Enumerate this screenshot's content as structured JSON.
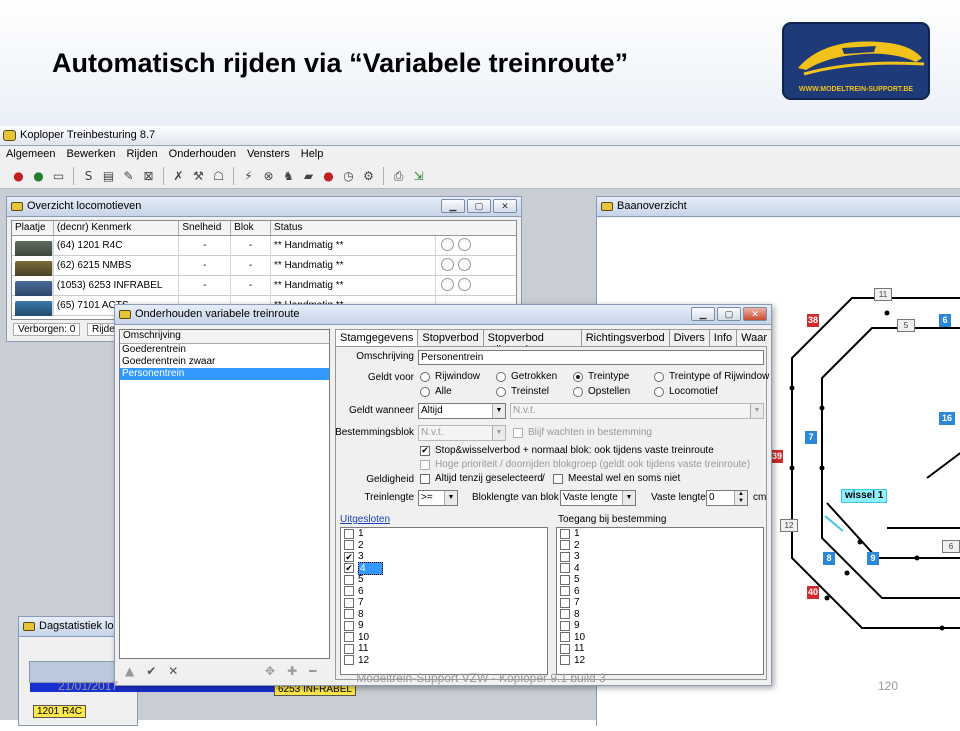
{
  "slide": {
    "title": "Automatisch rijden via “Variabele treinroute”",
    "logo_text": "WWW.MODELTREIN-SUPPORT.BE",
    "footer_date": "21/01/2017",
    "footer_center": "Modeltrein-Support  VZW - Koploper 9.1 build 3",
    "page_number": "120"
  },
  "app": {
    "title": "Koploper Treinbesturing 8.7",
    "menu": [
      "Algemeen",
      "Bewerken",
      "Rijden",
      "Onderhouden",
      "Vensters",
      "Help"
    ]
  },
  "loco_window": {
    "title": "Overzicht locomotieven",
    "columns": [
      "Plaatje",
      "(decnr) Kenmerk",
      "Snelheid",
      "Blok",
      "Status"
    ],
    "rows": [
      {
        "kenmerk": "(64) 1201 R4C",
        "snelheid": "-",
        "blok": "-",
        "status": "** Handmatig **"
      },
      {
        "kenmerk": "(62) 6215 NMBS",
        "snelheid": "-",
        "blok": "-",
        "status": "** Handmatig **"
      },
      {
        "kenmerk": "(1053) 6253 INFRABEL",
        "snelheid": "-",
        "blok": "-",
        "status": "** Handmatig **"
      },
      {
        "kenmerk": "(65) 7101 ACTS",
        "snelheid": "-",
        "blok": "-",
        "status": "** Handmatig **"
      }
    ],
    "verborgen": "Verborgen: 0",
    "rijden": "Rijden"
  },
  "baan_window": {
    "title": "Baanoverzicht",
    "blocks": {
      "b38": "38",
      "b39": "39",
      "b40": "40",
      "b6": "6",
      "b7": "7",
      "b8": "8",
      "b9": "9",
      "b16": "16",
      "w11": "11",
      "w5": "5",
      "w12": "12",
      "w6": "6"
    },
    "wissel_label": "wissel 1"
  },
  "stats_window": {
    "title": "Dagstatistiek lo",
    "bar_label": "6253 INFRABEL",
    "bottom_label": "1201 R4C"
  },
  "route_window": {
    "title": "Onderhouden variabele treinroute",
    "list_header": "Omschrijving",
    "items": [
      "Goederentrein",
      "Goederentrein zwaar",
      "Personentrein"
    ],
    "tabs": [
      "Stamgegevens",
      "Stopverbod",
      "Stopverbod stilstand",
      "Richtingsverbod",
      "Divers",
      "Info",
      "Waar"
    ],
    "omschrijving_label": "Omschrijving",
    "omschrijving_value": "Personentrein",
    "geldt_voor_label": "Geldt voor",
    "geldt_voor_options": [
      "Rijwindow",
      "Getrokken",
      "Treintype",
      "Treintype of Rijwindow",
      "Alle",
      "Treinstel",
      "Opstellen",
      "Locomotief"
    ],
    "geldt_wanneer_label": "Geldt wanneer",
    "geldt_wanneer_value": "Altijd",
    "nvt": "N.v.t.",
    "bestemmingsblok_label": "Bestemmingsblok",
    "blijf_label": "Blijf wachten in bestemming",
    "stop_label": "Stop&wisselverbod + normaal blok: ook tijdens vaste treinroute",
    "hoge_label": "Hoge prioriteit / doorrijden blokgroep (geldt ook tijdens vaste treinroute)",
    "geldigheid_label": "Geldigheid",
    "altijd_label": "Altijd tenzij geselecteerd",
    "slash": "/",
    "meestal_label": "Meestal wel en soms niet",
    "treinlengte_label": "Treinlengte",
    "treinlengte_value": ">=",
    "bloklengte_label": "Bloklengte van blok",
    "bloklengte_value": "Vaste lengte",
    "vaste_lengte_label": "Vaste lengte",
    "vaste_lengte_value": "0",
    "cm": "cm",
    "uitgesloten_label": "Uitgesloten",
    "toegang_label": "Toegang bij bestemming",
    "numbers": [
      "1",
      "2",
      "3",
      "4",
      "5",
      "6",
      "7",
      "8",
      "9",
      "10",
      "11",
      "12"
    ]
  },
  "colors": {
    "selection": "#3399ff",
    "block_blue": "#2b88d8",
    "block_red": "#d12a2a",
    "title_bar": "#c6d4e8"
  }
}
